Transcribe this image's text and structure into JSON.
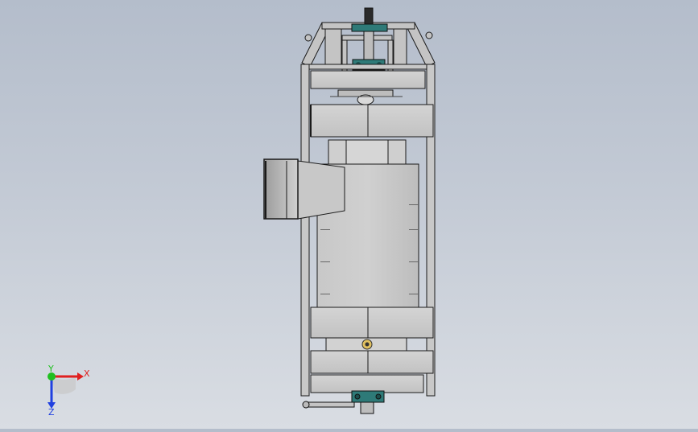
{
  "viewport": {
    "background_top": "#b4bdcb",
    "background_bottom": "#d9dde3",
    "part_fill": "#c9c9c9",
    "part_fill_light": "#d8d8d8",
    "part_fill_dark": "#9a9a9a",
    "edge_color": "#1a1a1a",
    "bearing_color": "#2e7a78"
  },
  "triad": {
    "x_label": "X",
    "y_label": "Y",
    "z_label": "Z",
    "x_color": "#e02020",
    "y_color": "#20c020",
    "z_color": "#2040e0"
  }
}
